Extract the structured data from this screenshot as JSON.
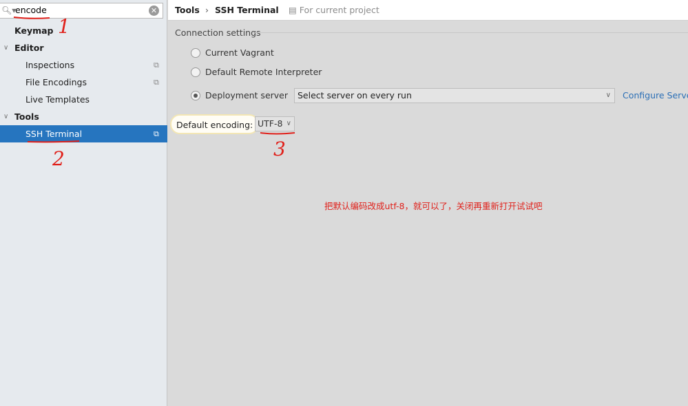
{
  "search": {
    "value": "encode",
    "icon": "search-icon",
    "clear_icon": "clear-icon"
  },
  "sidebar": {
    "items": [
      {
        "label": "Keymap",
        "level": "top"
      },
      {
        "label": "Editor",
        "level": "top",
        "expanded": true
      },
      {
        "label": "Inspections",
        "level": "sub",
        "project_icon": true
      },
      {
        "label": "File Encodings",
        "level": "sub",
        "project_icon": true
      },
      {
        "label": "Live Templates",
        "level": "sub"
      },
      {
        "label": "Tools",
        "level": "top",
        "expanded": true
      },
      {
        "label": "SSH Terminal",
        "level": "sub",
        "project_icon": true,
        "selected": true
      }
    ]
  },
  "header": {
    "crumb1": "Tools",
    "separator": "›",
    "crumb2": "SSH Terminal",
    "scope": "For current project"
  },
  "connection": {
    "group_label": "Connection settings",
    "options": [
      {
        "label": "Current Vagrant",
        "checked": false
      },
      {
        "label": "Default Remote Interpreter",
        "checked": false
      },
      {
        "label": "Deployment server",
        "checked": true
      }
    ],
    "server_select": "Select server on every run",
    "configure_link": "Configure Servers"
  },
  "encoding": {
    "label": "Default encoding:",
    "value": "UTF-8"
  },
  "annotations": {
    "note": "把默认编码改成utf-8，就可以了，关闭再重新打开试试吧",
    "markers": [
      "1",
      "2",
      "3"
    ],
    "color": "#e0201a"
  },
  "colors": {
    "selection": "#2675bf",
    "link": "#2b6fb6"
  }
}
